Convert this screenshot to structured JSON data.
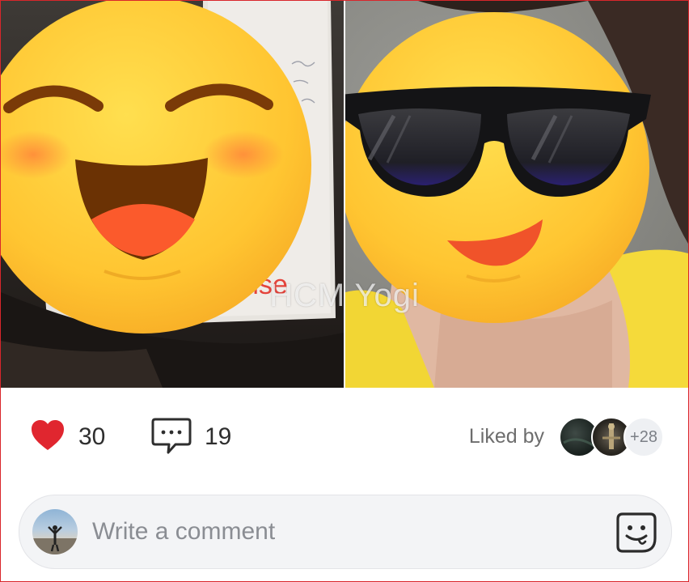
{
  "post": {
    "watermark": "HCM Yogi",
    "photo_left_text": "rise"
  },
  "stats": {
    "likes_count": "30",
    "comments_count": "19",
    "liked_by_label": "Liked by",
    "liked_by_more": "+28",
    "like_icon": "heart-icon",
    "comment_icon": "comment-bubble-icon"
  },
  "comment_box": {
    "placeholder": "Write a comment",
    "emoji_icon": "sticker-smiley-icon"
  },
  "colors": {
    "heart": "#e0262f",
    "frame_border": "#d9262b",
    "text": "#2e2e2e",
    "muted_text": "#6d6d6d"
  }
}
